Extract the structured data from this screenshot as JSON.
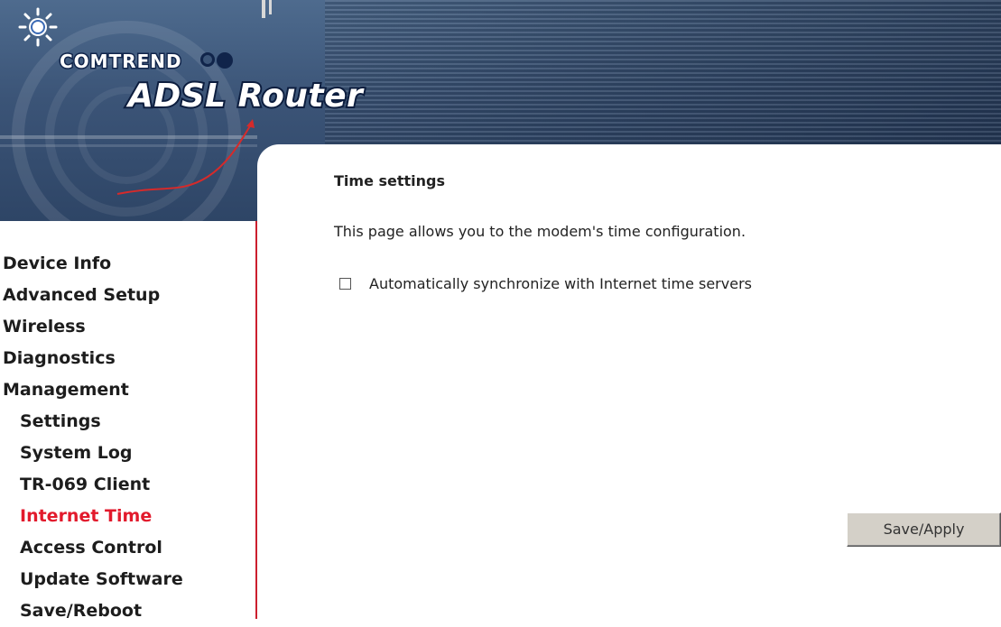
{
  "header": {
    "brand": "COMTREND",
    "product": "ADSL Router",
    "logo_icon": "comtrend-sun-logo-icon"
  },
  "sidebar": {
    "items": [
      {
        "label": "Device Info"
      },
      {
        "label": "Advanced Setup"
      },
      {
        "label": "Wireless"
      },
      {
        "label": "Diagnostics"
      },
      {
        "label": "Management"
      },
      {
        "label": "Settings"
      },
      {
        "label": "System Log"
      },
      {
        "label": "TR-069 Client"
      },
      {
        "label": "Internet Time",
        "active": true
      },
      {
        "label": "Access Control"
      },
      {
        "label": "Update Software"
      },
      {
        "label": "Save/Reboot"
      }
    ]
  },
  "main": {
    "title": "Time settings",
    "description": "This page allows you to the modem's time configuration.",
    "sync_label": "Automatically synchronize with Internet time servers",
    "sync_checked": false,
    "save_label": "Save/Apply"
  },
  "colors": {
    "active_nav": "#e21a2c",
    "sidebar_border": "#cc1f2e",
    "banner": "#3b5477"
  }
}
